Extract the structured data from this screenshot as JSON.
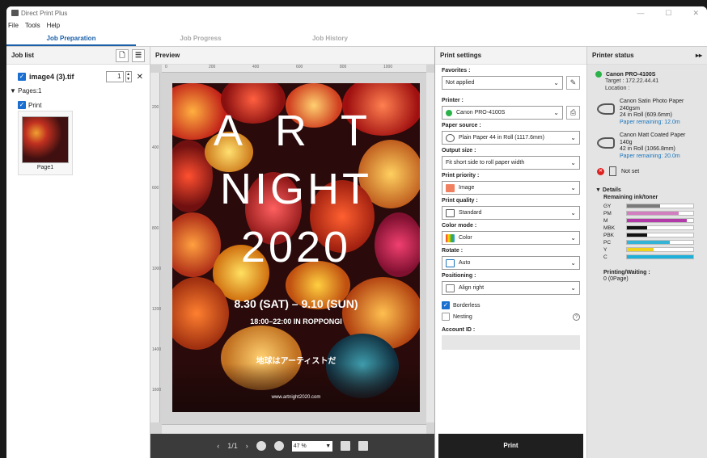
{
  "window": {
    "title": "Direct Print Plus",
    "controls": [
      "—",
      "☐",
      "✕"
    ]
  },
  "menu": [
    "File",
    "Tools",
    "Help"
  ],
  "tabs": [
    {
      "label": "Job Preparation",
      "active": true
    },
    {
      "label": "Job Progress",
      "active": false
    },
    {
      "label": "Job History",
      "active": false
    }
  ],
  "joblist": {
    "title": "Job list",
    "file_name": "image4 (3).tif",
    "copies": "1",
    "pages_label": "Pages:1",
    "print_label": "Print",
    "page_name": "Page1"
  },
  "preview": {
    "title": "Preview",
    "ruler_top": [
      "0",
      "200",
      "400",
      "600",
      "800",
      "1000"
    ],
    "ruler_left": [
      "200",
      "400",
      "600",
      "800",
      "1000",
      "1200",
      "1400",
      "1600"
    ],
    "poster": {
      "line1": "A R T",
      "line2": "NIGHT",
      "line3": "2020",
      "dates": "8.30 (SAT) – 9.10 (SUN)",
      "times": "18:00–22:00 IN ROPPONGI",
      "jp": "地球はアーティストだ",
      "url": "www.artnight2020.com"
    },
    "page_indicator": "1/1",
    "zoom": "47 %"
  },
  "settings": {
    "title": "Print settings",
    "favorites_label": "Favorites",
    "favorites_value": "Not applied",
    "printer_label": "Printer",
    "printer_value": "Canon PRO-4100S",
    "paper_source_label": "Paper source",
    "paper_source_value": "Plain Paper 44 in Roll (1117.6mm)",
    "output_size_label": "Output size",
    "output_size_value": "Fit short side to roll paper width",
    "priority_label": "Print priority",
    "priority_value": "Image",
    "quality_label": "Print quality",
    "quality_value": "Standard",
    "color_mode_label": "Color mode",
    "color_mode_value": "Color",
    "rotate_label": "Rotate",
    "rotate_value": "Auto",
    "positioning_label": "Positioning",
    "positioning_value": "Align right",
    "borderless_label": "Borderless",
    "borderless_checked": true,
    "nesting_label": "Nesting",
    "nesting_checked": false,
    "account_label": "Account ID",
    "colon": ":",
    "print_button": "Print"
  },
  "status": {
    "title": "Printer status",
    "printer_name": "Canon PRO-4100S",
    "target": "Target : 172.22.44.41",
    "location": "Location :",
    "rolls": [
      {
        "paper": "Canon Satin Photo Paper",
        "weight": "240gsm",
        "size": "24 in Roll (609.6mm)",
        "remaining": "Paper remaining: 12.0m"
      },
      {
        "paper": "Canon Matt Coated Paper",
        "weight": "140g",
        "size": "42 in Roll (1066.8mm)",
        "remaining": "Paper remaining: 20.0m"
      }
    ],
    "not_set": "Not set",
    "details_label": "▼ Details",
    "remaining_ink_label": "Remaining ink/toner",
    "inks": [
      {
        "name": "GY",
        "level": 0.5,
        "color": "#7a7a7a"
      },
      {
        "name": "PM",
        "level": 0.78,
        "color": "#d27fc0"
      },
      {
        "name": "M",
        "level": 0.9,
        "color": "#b23aa8"
      },
      {
        "name": "MBK",
        "level": 0.3,
        "color": "#111111"
      },
      {
        "name": "PBK",
        "level": 0.3,
        "color": "#111111"
      },
      {
        "name": "PC",
        "level": 0.65,
        "color": "#33b4d6"
      },
      {
        "name": "Y",
        "level": 0.4,
        "color": "#f1d21b"
      },
      {
        "name": "C",
        "level": 1.0,
        "color": "#1eb0d8"
      }
    ],
    "printing_waiting_label": "Printing/Waiting :",
    "printing_waiting_value": "0 (0Page)"
  }
}
